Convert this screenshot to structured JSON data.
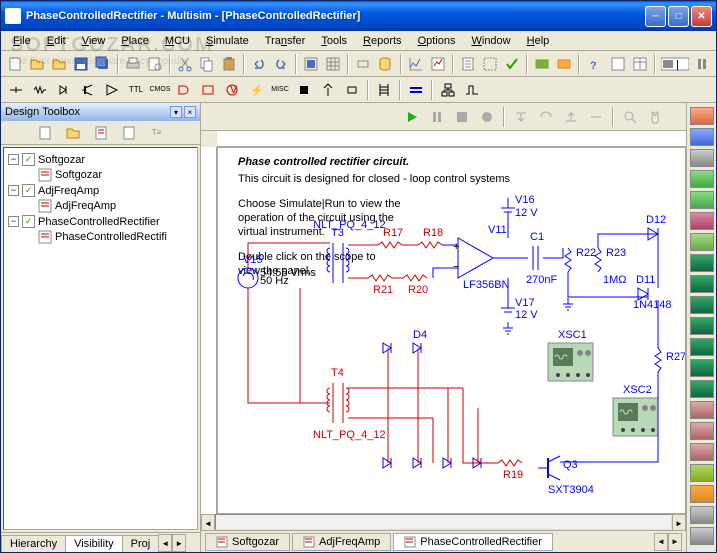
{
  "window": {
    "title": "PhaseControlledRectifier - Multisim - [PhaseControlledRectifier]"
  },
  "menubar": {
    "items": [
      "File",
      "Edit",
      "View",
      "Place",
      "MCU",
      "Simulate",
      "Transfer",
      "Tools",
      "Reports",
      "Options",
      "Window",
      "Help"
    ]
  },
  "sidebar": {
    "title": "Design Toolbox",
    "tree": [
      {
        "name": "Softgozar",
        "checked": true,
        "children": [
          {
            "name": "Softgozar"
          }
        ]
      },
      {
        "name": "AdjFreqAmp",
        "checked": true,
        "children": [
          {
            "name": "AdjFreqAmp"
          }
        ]
      },
      {
        "name": "PhaseControlledRectifier",
        "checked": true,
        "children": [
          {
            "name": "PhaseControlledRectifi"
          }
        ]
      }
    ],
    "tabs": [
      "Hierarchy",
      "Visibility",
      "Proj"
    ]
  },
  "schematic": {
    "title": "Phase controlled rectifier circuit.",
    "desc1": "This circuit is designed for closed - loop control systems",
    "desc2": "Choose Simulate|Run to view the",
    "desc3": "operation of the circuit using the",
    "desc4": "virtual instrument.",
    "desc5": "Double click on the scope to",
    "desc6": "view the panel.",
    "components": {
      "V15": "V15",
      "V16": "V16",
      "V17": "V17",
      "V11": "V11",
      "T3": "T3",
      "T4": "T4",
      "C1": "C1",
      "D4": "D4",
      "D12": "D12",
      "D11": "D11",
      "R17": "R17",
      "R18": "R18",
      "R19": "R19",
      "R20": "R20",
      "R21": "R21",
      "R22": "R22",
      "R23": "R23",
      "R27": "R27",
      "Q3": "Q3",
      "XSC1": "XSC1",
      "XSC2": "XSC2",
      "voltage1": "54.55 Vrms",
      "freq1": "50 Hz",
      "voltage2": "12 V",
      "opamp": "LF356BN",
      "transistor": "SXT3904",
      "nlt1": "NLT_PQ_4_12",
      "nlt2": "NLT_PQ_4_12",
      "cap1": "270nF",
      "res1": "1MΩ",
      "diode1": "1N4148"
    }
  },
  "bottom_tabs": [
    "Softgozar",
    "AdjFreqAmp",
    "PhaseControlledRectifier"
  ],
  "watermark": "SOFTGOZAR.COM",
  "watermark_sub": "The First Iranian Software Encyclopedia"
}
